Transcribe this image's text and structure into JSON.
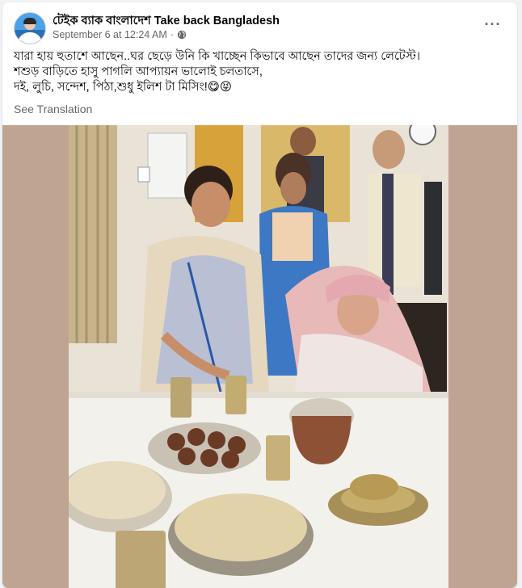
{
  "post": {
    "page_name": "টেইক ব্যাক বাংলাদেশ Take back Bangladesh",
    "timestamp": "September 6 at 12:24 AM",
    "separator": "·",
    "privacy_icon": "globe-icon",
    "more_icon": "more-options-icon",
    "text_lines": [
      "যারা হায় হুতাশে আছেন..ঘর ছেড়ে উনি কি খাচ্ছেন কিভাবে আছেন তাদের জন্য লেটেস্ট।",
      "শশুড় বাড়িতে হাসু পাগলি আপ্যায়ন ভালোই চলতাসে,",
      "দই, লুচি, সন্দেশ, পিঠা,শুধু ইলিশ টা মিসিং!😋😝"
    ],
    "see_translation": "See Translation"
  },
  "colors": {
    "text_primary": "#050505",
    "text_secondary": "#65676b",
    "background": "#f0f2f5",
    "card": "#ffffff"
  }
}
